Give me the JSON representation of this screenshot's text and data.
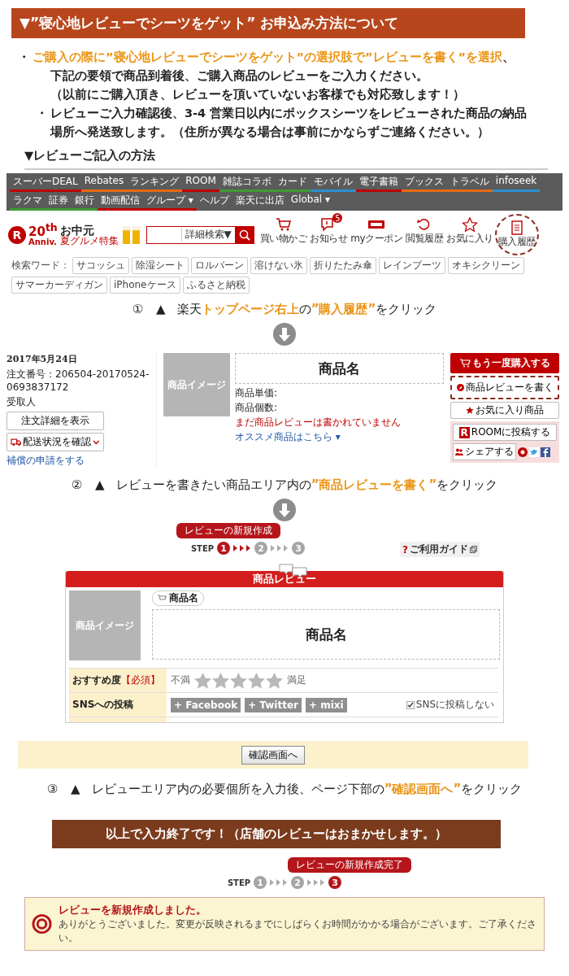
{
  "header": {
    "title": "▼”寝心地レビューでシーツをゲット” お申込み方法について"
  },
  "notes": [
    {
      "bullet": "・",
      "lines": [
        [
          {
            "text": "ご購入の際に”寝心地レビューでシーツをゲット”の選択肢で”レビューを書く”を選択",
            "highlight": true
          },
          {
            "text": "、",
            "highlight": false
          }
        ],
        [
          {
            "text": "下記の要領で商品到着後、ご購入商品のレビューをご入力ください。",
            "highlight": false
          }
        ],
        [
          {
            "text": "（以前にご購入頂き、レビューを頂いていないお客様でも対応致します！）",
            "highlight": false
          }
        ]
      ]
    },
    {
      "bullet": "・",
      "lines": [
        [
          {
            "text": "レビューご入力確認後、3-4 営業日以内にボックスシーツをレビューされた商品の納品",
            "highlight": false
          }
        ],
        [
          {
            "text": "場所へ発送致します。（住所が異なる場合は事前にかならずご連絡ください。）",
            "highlight": false
          }
        ]
      ]
    }
  ],
  "how_to": {
    "title": "▼レビューご記入の方法"
  },
  "step1": {
    "nav": [
      {
        "label": "スーパーDEAL",
        "color": "#bf0000"
      },
      {
        "label": "Rebates",
        "color": "#e86a10"
      },
      {
        "label": "ランキング",
        "color": "#e86a10"
      },
      {
        "label": "ROOM",
        "color": "#bf0000"
      },
      {
        "label": "雑誌コラボ",
        "color": "#3d9b35"
      },
      {
        "label": "カード",
        "color": "#3d9b35"
      },
      {
        "label": "モバイル",
        "color": "#2a8fd0"
      },
      {
        "label": "電子書籍",
        "color": "#bf0000"
      },
      {
        "label": "ブックス",
        "color": "#e86a10"
      },
      {
        "label": "トラベル",
        "color": "#e86a10"
      },
      {
        "label": "infoseek",
        "color": "#2a8fd0"
      },
      {
        "label": "ラクマ",
        "color": "#3d9b35"
      },
      {
        "label": "証券",
        "color": "#3d9b35"
      },
      {
        "label": "銀行",
        "color": "#3d9b35"
      },
      {
        "label": "動画配信",
        "color": "#bf0000"
      },
      {
        "label": "グループ ▾",
        "color": "#bf0000"
      },
      {
        "label": "ヘルプ"
      },
      {
        "label": "楽天に出店"
      },
      {
        "label": "Global ▾"
      }
    ],
    "logo": {
      "mark": "R",
      "number": "20$^{th}$",
      "word": "Anniv."
    },
    "campaign": {
      "title": "お中元",
      "subtitle": "夏グルメ特集"
    },
    "search": {
      "option": "詳細検索▼"
    },
    "links": [
      {
        "label": "買い物かご",
        "kind": "cart",
        "highlighted": false
      },
      {
        "label": "お知らせ",
        "kind": "bell",
        "badge": "5",
        "highlighted": false
      },
      {
        "label": "myクーポン",
        "kind": "coupon",
        "highlighted": false
      },
      {
        "label": "閲覧履歴",
        "kind": "history",
        "highlighted": false
      },
      {
        "label": "お気に入り",
        "kind": "star",
        "highlighted": false
      },
      {
        "label": "購入履歴",
        "kind": "document",
        "highlighted": true
      }
    ],
    "keywords": {
      "label": "検索ワード：",
      "items": [
        "サコッシュ",
        "除湿シート",
        "ロルバーン",
        "溶けない氷",
        "折りたたみ傘",
        "レインブーツ",
        "オキシクリーン",
        "サマーカーディガン",
        "iPhoneケース",
        "ふるさと納税"
      ]
    },
    "caption": {
      "number": "①",
      "marker": "▲",
      "segments": [
        {
          "text": "楽天",
          "highlight": false
        },
        {
          "text": "トップページ右上",
          "highlight": true
        },
        {
          "text": "の",
          "highlight": false
        },
        {
          "text": "”購入履歴”",
          "highlight": true
        },
        {
          "text": "をクリック",
          "highlight": false
        }
      ]
    }
  },
  "step2": {
    "order": {
      "date": "2017年5月24日",
      "number": "注文番号：206504-20170524-0693837172",
      "recipient": "受取人",
      "buttons": [
        "注文詳細を表示",
        "配送状況を確認"
      ],
      "link": "補償の申請をする"
    },
    "item": {
      "image": "商品イメージ",
      "name": "商品名",
      "price": "商品単価:",
      "quantity": "商品個数:",
      "review_status": "まだ商品レビューは書かれていません",
      "recommend": "オススメ商品はこちら ▾"
    },
    "actions": [
      {
        "label": "もう一度購入する",
        "kind": "buy",
        "highlighted": false
      },
      {
        "label": "商品レビューを書く",
        "kind": "review",
        "highlighted": true
      },
      {
        "label": "お気に入り商品",
        "kind": "favorite",
        "highlighted": false
      }
    ],
    "share": {
      "room": "ROOMに投稿する",
      "room_mark": "R",
      "share": "シェアする"
    },
    "caption": {
      "number": "②",
      "marker": "▲",
      "segments": [
        {
          "text": "レビューを書きたい商品エリア内の",
          "highlight": false
        },
        {
          "text": "”商品レビューを書く”",
          "highlight": true
        },
        {
          "text": "をクリック",
          "highlight": false
        }
      ]
    }
  },
  "step3": {
    "steps": {
      "tooltip": "レビューの新規作成",
      "label": "STEP",
      "items": [
        {
          "number": "1",
          "selected": true
        },
        {
          "number": "2",
          "selected": false
        },
        {
          "number": "3",
          "selected": false
        }
      ]
    },
    "guide": {
      "mark": "?",
      "label": "ご利用ガイド"
    },
    "form": {
      "title": "商品レビュー",
      "image": "商品イメージ",
      "name_tag": "商品名",
      "name": "商品名",
      "rating": {
        "label": "おすすめ度",
        "required": "【必須】",
        "low": "不満",
        "high": "満足",
        "stars": 0
      },
      "sns": {
        "label": "SNSへの投稿",
        "buttons": [
          "+ Facebook",
          "+ Twitter",
          "+ mixi"
        ],
        "opt_out": {
          "label": "SNSに投稿しない",
          "checked": true
        }
      }
    },
    "confirm": "確認画面へ",
    "caption": {
      "number": "③",
      "marker": "▲",
      "segments": [
        {
          "text": "レビューエリア内の必要個所を入力後、ページ下部の",
          "highlight": false
        },
        {
          "text": "”確認画面へ”",
          "highlight": true
        },
        {
          "text": "をクリック",
          "highlight": false
        }
      ]
    }
  },
  "closing": {
    "title": "以上で入力終了です！（店舗のレビューはおまかせします。）"
  },
  "completion": {
    "steps": {
      "tooltip": "レビューの新規作成完了",
      "label": "STEP",
      "items": [
        {
          "number": "1",
          "selected": false
        },
        {
          "number": "2",
          "selected": false
        },
        {
          "number": "3",
          "selected": true
        }
      ]
    },
    "message": {
      "title": "レビューを新規作成しました。",
      "body": "ありがとうございました。変更が反映されるまでにしばらくお時間がかかる場合がございます。ご了承ください。"
    }
  }
}
